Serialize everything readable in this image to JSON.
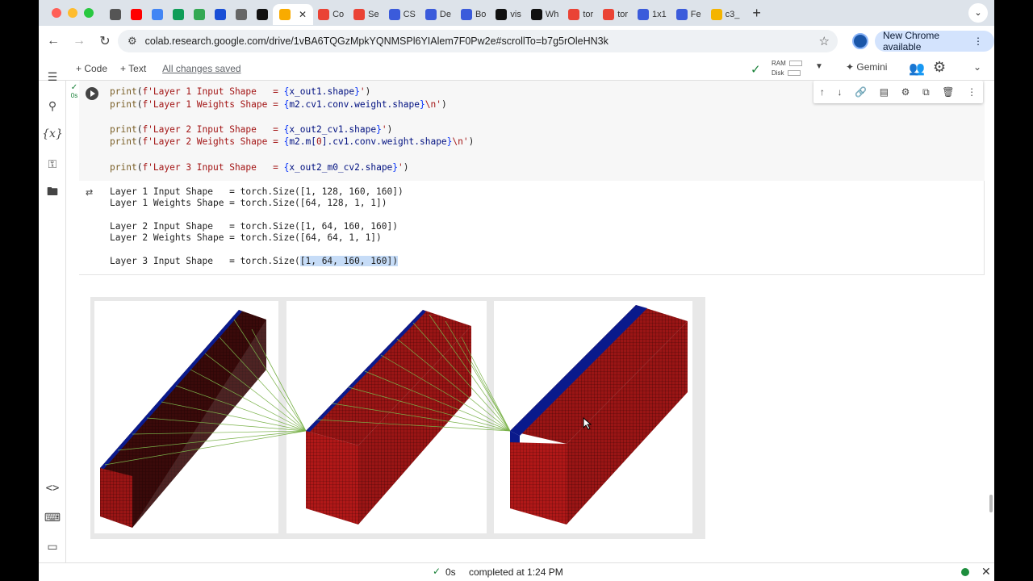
{
  "browser": {
    "tabs": [
      {
        "label": "",
        "color": "#555555",
        "icon": "openai-icon"
      },
      {
        "label": "",
        "color": "#ff0000",
        "icon": "youtube-icon"
      },
      {
        "label": "",
        "color": "#4285f4",
        "icon": "docs-icon"
      },
      {
        "label": "",
        "color": "#0f9d58",
        "icon": "sheets-icon"
      },
      {
        "label": "",
        "color": "#34a853",
        "icon": "drive-icon"
      },
      {
        "label": "",
        "color": "#1a4fd6",
        "icon": "dropbox-icon"
      },
      {
        "label": "",
        "color": "#666666",
        "icon": "globe-icon"
      },
      {
        "label": "",
        "color": "#111111",
        "icon": "github-icon"
      },
      {
        "label": "",
        "color": "#f9ab00",
        "icon": "colab-icon",
        "active": true
      },
      {
        "label": "Co",
        "color": "#ea4335",
        "icon": "pytorch-icon"
      },
      {
        "label": "Se",
        "color": "#ea4335",
        "icon": "pytorch-icon"
      },
      {
        "label": "CS",
        "color": "#3b5bdb",
        "icon": "arxiv-icon"
      },
      {
        "label": "De",
        "color": "#3b5bdb",
        "icon": "arxiv-icon"
      },
      {
        "label": "Bo",
        "color": "#3b5bdb",
        "icon": "arxiv-icon"
      },
      {
        "label": "vis",
        "color": "#111111",
        "icon": "github-icon"
      },
      {
        "label": "Wh",
        "color": "#111111",
        "icon": "github-icon"
      },
      {
        "label": "tor",
        "color": "#ea4335",
        "icon": "pytorch-icon"
      },
      {
        "label": "tor",
        "color": "#ea4335",
        "icon": "pytorch-icon"
      },
      {
        "label": "1x1",
        "color": "#3b5bdb",
        "icon": "arxiv-icon"
      },
      {
        "label": "Fe",
        "color": "#3b5bdb",
        "icon": "arxiv-icon"
      },
      {
        "label": "c3_",
        "color": "#f4b400",
        "icon": "slides-icon"
      }
    ],
    "url": "colab.research.google.com/drive/1vBA6TQGzMpkYQNMSPl6YIAlem7F0Pw2e#scrollTo=b7g5rOleHN3k",
    "update_label": "New Chrome available"
  },
  "colab": {
    "add_code": "+ Code",
    "add_text": "+ Text",
    "saved": "All changes saved",
    "ram": "RAM",
    "disk": "Disk",
    "gemini": "Gemini"
  },
  "cell": {
    "exec_time": "0s",
    "output_lines": [
      "Layer 1 Input Shape   = torch.Size([1, 128, 160, 160])",
      "Layer 1 Weights Shape = torch.Size([64, 128, 1, 1])",
      "",
      "Layer 2 Input Shape   = torch.Size([1, 64, 160, 160])",
      "Layer 2 Weights Shape = torch.Size([64, 64, 1, 1])",
      "",
      "Layer 3 Input Shape   = torch.Size("
    ],
    "output_selected": "[1, 64, 160, 160])"
  },
  "status": {
    "time": "0s",
    "message": "completed at 1:24 PM"
  },
  "colors": {
    "tensor_red": "#b01818",
    "tensor_dark": "#3a0a0a",
    "tensor_blue": "#0a1a8c",
    "link_green": "#7ab24a",
    "accent": "#1a73e8"
  }
}
